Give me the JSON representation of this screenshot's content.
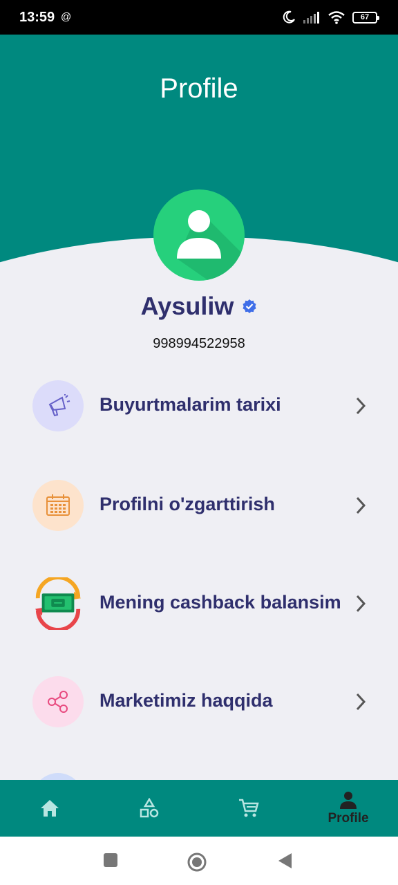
{
  "status_bar": {
    "time": "13:59",
    "at_symbol": "@",
    "battery": "67"
  },
  "header": {
    "title": "Profile"
  },
  "user": {
    "name": "Aysuliw",
    "phone": "998994522958"
  },
  "menu": {
    "items": [
      {
        "label": "Buyurtmalarim tarixi",
        "icon": "megaphone-icon",
        "icon_bg": "#dcdcfa"
      },
      {
        "label": "Profilni o'zgarttirish",
        "icon": "calendar-icon",
        "icon_bg": "#fde3cc"
      },
      {
        "label": "Mening cashback balansim",
        "icon": "cashback-icon",
        "icon_bg": "transparent"
      },
      {
        "label": "Marketimiz haqqida",
        "icon": "share-icon",
        "icon_bg": "#fcdcec"
      }
    ]
  },
  "bottom_nav": {
    "items": [
      {
        "name": "home-icon",
        "label": ""
      },
      {
        "name": "categories-icon",
        "label": ""
      },
      {
        "name": "cart-icon",
        "label": ""
      },
      {
        "name": "profile-icon",
        "label": "Profile"
      }
    ]
  },
  "colors": {
    "primary": "#00897f",
    "avatar": "#26d07c",
    "text_primary": "#2f2f6d",
    "background": "#efeff4",
    "verified": "#3f6ee8"
  }
}
